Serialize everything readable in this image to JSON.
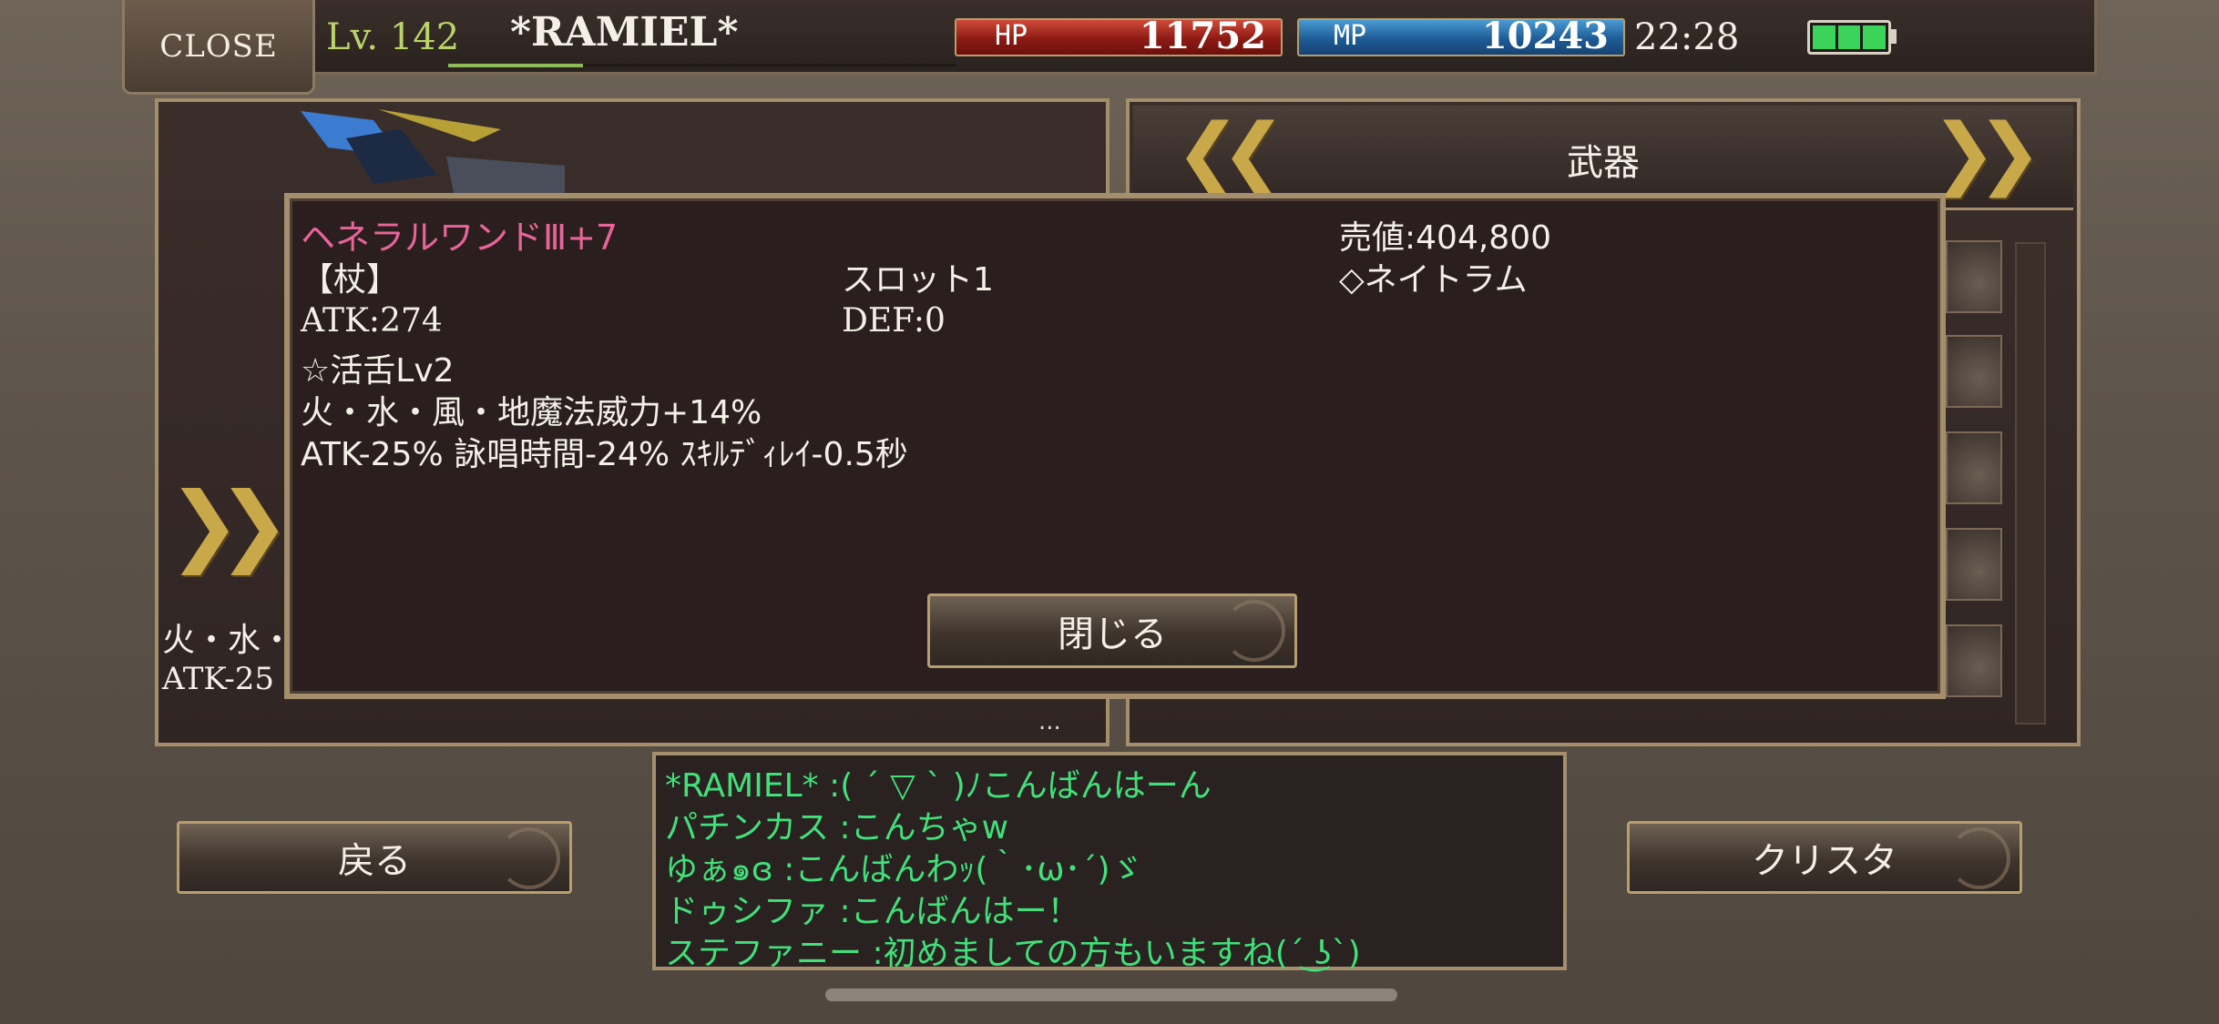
{
  "header": {
    "close_label": "CLOSE",
    "level": "Lv. 142",
    "player_name": "*RAMIEL*",
    "hp_label": "HP",
    "hp_value": "11752",
    "mp_label": "MP",
    "mp_value": "10243",
    "clock": "22:28"
  },
  "right_panel": {
    "category_title": "武器"
  },
  "left_panel": {
    "text_line1": "火・水・",
    "text_line2": "ATK-25",
    "ellipsis": "..."
  },
  "item_dialog": {
    "name": "ヘネラルワンドⅢ+7",
    "category": "【杖】",
    "slot": "スロット1",
    "price": "売値:404,800",
    "element": "◇ネイトラム",
    "atk": "ATK:274",
    "def": "DEF:0",
    "skill": "☆活舌Lv2",
    "magic_bonus": "火・水・風・地魔法威力+14%",
    "penalty": "ATK-25% 詠唱時間-24% ｽｷﾙﾃﾞｨﾚｲ-0.5秒",
    "close_button": "閉じる",
    "name_color": "#e8649a"
  },
  "buttons": {
    "back": "戻る",
    "crysta": "クリスタ"
  },
  "chat": [
    "*RAMIEL* :( ´ ▽ ` )ﾉこんばんはーん",
    "パチンカス :こんちゃw",
    "ゆぁ๑ɞ :こんばんわｯ(｀･ω･´)ゞ",
    "ドゥシファ :こんばんはー！",
    "ステファニー :初めましての方もいますね(´ ͜ʖ`)"
  ],
  "icons": {
    "left_arrow": "double-chevron-left-icon",
    "right_arrow": "double-chevron-right-icon",
    "battery": "battery-icon"
  },
  "colors": {
    "hp": "#b52a1f",
    "mp": "#2a73b5",
    "chat_text": "#41e07a",
    "accent_gold": "#c9a84a"
  }
}
